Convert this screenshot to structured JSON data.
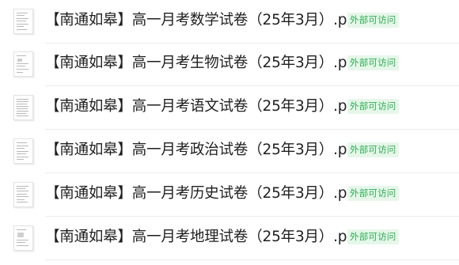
{
  "files": [
    {
      "name": "【南通如皋】高一月考数学试卷（25年3月）.pdf",
      "icon": "pdf-file-icon",
      "badge": "外部可访问"
    },
    {
      "name": "【南通如皋】高一月考生物试卷（25年3月）.pdf",
      "icon": "pdf-file-icon",
      "badge": "外部可访问"
    },
    {
      "name": "【南通如皋】高一月考语文试卷（25年3月）.pdf",
      "icon": "pdf-file-icon",
      "badge": "外部可访问"
    },
    {
      "name": "【南通如皋】高一月考政治试卷（25年3月）.pdf",
      "icon": "pdf-file-icon",
      "badge": "外部可访问"
    },
    {
      "name": "【南通如皋】高一月考历史试卷（25年3月）.pdf",
      "icon": "pdf-file-icon",
      "badge": "外部可访问"
    },
    {
      "name": "【南通如皋】高一月考地理试卷（25年3月）.pdf",
      "icon": "pdf-file-icon",
      "badge": "外部可访问"
    }
  ],
  "colors": {
    "badge_text": "#2fae53",
    "badge_bg": "#e6f7ea",
    "divider": "#ececec",
    "text": "#1f1f1f"
  }
}
